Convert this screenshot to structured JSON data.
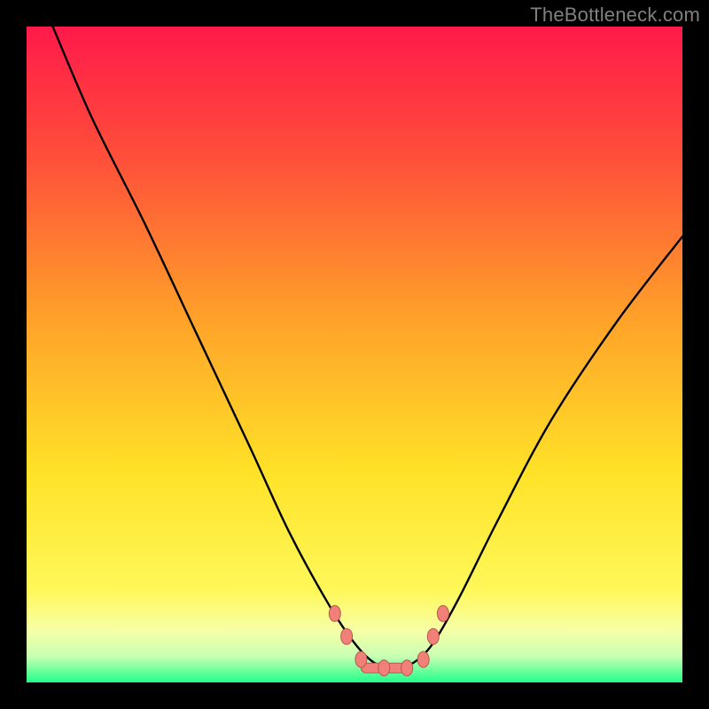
{
  "watermark": "TheBottleneck.com",
  "chart_data": {
    "type": "line",
    "title": "",
    "xlabel": "",
    "ylabel": "",
    "xlim": [
      0,
      100
    ],
    "ylim": [
      0,
      100
    ],
    "grid": false,
    "gradient_stops": [
      {
        "offset": 0,
        "color": "#ff1a4a"
      },
      {
        "offset": 0.2,
        "color": "#ff4f3a"
      },
      {
        "offset": 0.45,
        "color": "#ffa329"
      },
      {
        "offset": 0.68,
        "color": "#ffe228"
      },
      {
        "offset": 0.86,
        "color": "#fff85a"
      },
      {
        "offset": 0.92,
        "color": "#f7ffa6"
      },
      {
        "offset": 0.96,
        "color": "#c9ffb3"
      },
      {
        "offset": 1.0,
        "color": "#21ff8a"
      }
    ],
    "series": [
      {
        "name": "bottleneck-curve",
        "x": [
          4,
          10,
          18,
          26,
          34,
          40,
          46,
          50,
          53,
          56,
          59,
          62,
          66,
          72,
          80,
          90,
          100
        ],
        "y": [
          100,
          86,
          70,
          53,
          36,
          23,
          12,
          6,
          3,
          2,
          3,
          6,
          13,
          25,
          40,
          55,
          68
        ]
      }
    ],
    "markers": {
      "name": "curve-markers",
      "x": [
        47.0,
        48.8,
        51.0,
        54.5,
        58.0,
        60.5,
        62.0,
        63.5
      ],
      "y": [
        10.5,
        7.0,
        3.5,
        2.2,
        2.2,
        3.5,
        7.0,
        10.5
      ],
      "color": "#f08078",
      "stroke": "#b85850"
    },
    "floor_band": {
      "y": 2.2,
      "x_start": 51.0,
      "x_end": 58.0,
      "color": "#f08078",
      "stroke": "#b85850"
    }
  }
}
